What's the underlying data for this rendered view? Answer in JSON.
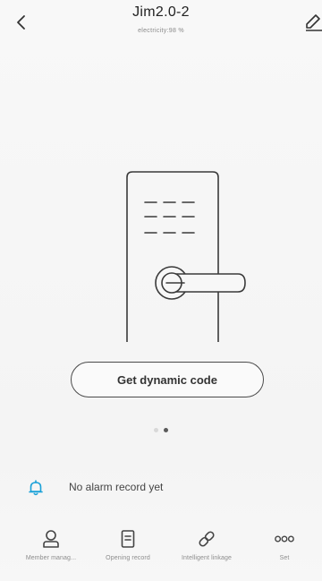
{
  "header": {
    "title": "Jim2.0-2",
    "subtitle": "electricity:98 %"
  },
  "icons": {
    "back": "chevron-left-icon",
    "edit": "pencil-icon",
    "alarm": "bell-icon",
    "member": "person-icon",
    "record": "document-icon",
    "linkage": "link-icon",
    "set": "more-dots-icon"
  },
  "main": {
    "code_button_label": "Get dynamic code",
    "pager": {
      "total": 2,
      "active_index": 1
    }
  },
  "alarm": {
    "text": "No alarm record yet"
  },
  "bottom_nav": {
    "items": [
      {
        "label": "Member manag..."
      },
      {
        "label": "Opening record"
      },
      {
        "label": "Intelligent linkage"
      },
      {
        "label": "Set"
      }
    ]
  },
  "colors": {
    "accent": "#1aa1d8",
    "text_primary": "#222222",
    "text_secondary": "#8c8c8c",
    "background": "#f6f6f6"
  }
}
